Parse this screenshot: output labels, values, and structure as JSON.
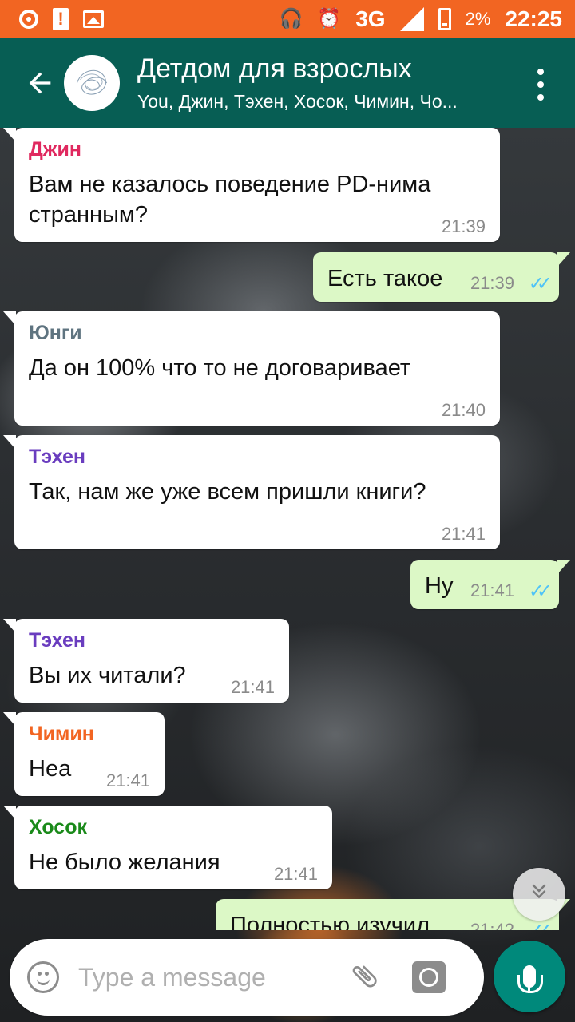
{
  "status_bar": {
    "network": "3G",
    "network_small": "3G",
    "battery": "2%",
    "time": "22:25",
    "icons": [
      "circle-notification-icon",
      "warning-icon",
      "image-icon",
      "headphones-icon",
      "alarm-icon",
      "signal-icon",
      "battery-low-icon"
    ]
  },
  "header": {
    "title": "Детдом для взрослых",
    "subtitle": "You, Джин, Тэхен, Хосок, Чимин, Чо..."
  },
  "colors": {
    "header": "#075e54",
    "status_bar": "#f26522",
    "incoming": "#ffffff",
    "outgoing": "#dcf8c6",
    "mic_button": "#00897b",
    "read_ticks": "#4fc3f7"
  },
  "messages": [
    {
      "direction": "in",
      "sender": "Джин",
      "sender_color": "#e0295f",
      "text": "Вам не казалось поведение PD-нима странным?",
      "time": "21:39"
    },
    {
      "direction": "out",
      "text": "Есть такое",
      "time": "21:39",
      "status": "read"
    },
    {
      "direction": "in",
      "sender": "Юнги",
      "sender_color": "#5f7480",
      "text": "Да он 100% что то не договаривает",
      "time": "21:40"
    },
    {
      "direction": "in",
      "sender": "Тэхен",
      "sender_color": "#6a3dbf",
      "text": "Так, нам же уже всем пришли книги?",
      "time": "21:41"
    },
    {
      "direction": "out",
      "text": "Ну",
      "time": "21:41",
      "status": "read"
    },
    {
      "direction": "in",
      "sender": "Тэхен",
      "sender_color": "#6a3dbf",
      "text": "Вы их читали?",
      "time": "21:41"
    },
    {
      "direction": "in",
      "sender": "Чимин",
      "sender_color": "#f26522",
      "text": "Неа",
      "time": "21:41"
    },
    {
      "direction": "in",
      "sender": "Хосок",
      "sender_color": "#1a8a1a",
      "text": "Не было желания",
      "time": "21:41"
    },
    {
      "direction": "out",
      "text": "Полностью изучил",
      "time": "21:42",
      "status": "read"
    }
  ],
  "input": {
    "placeholder": "Type a message"
  }
}
